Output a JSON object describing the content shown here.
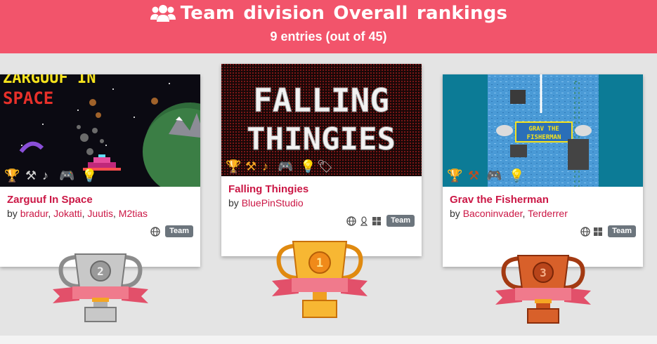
{
  "header": {
    "icon": "users-icon",
    "title": "Team division Overall rankings",
    "subtitle": "9 entries (out of 45)",
    "bg_color": "#f2546b"
  },
  "cards": [
    {
      "rank": 2,
      "thumb_text": "ZARGUUF IN SPACE",
      "title": "Zarguuf In Space",
      "by_prefix": "by",
      "authors": [
        "bradur",
        "Jokatti",
        "Juutis",
        "M2tias"
      ],
      "platforms": [
        "web-icon"
      ],
      "badge": "Team",
      "trophy": "silver-trophy"
    },
    {
      "rank": 1,
      "thumb_text_1": "FALLING",
      "thumb_text_2": "THINGIES",
      "title": "Falling Thingies",
      "by_prefix": "by",
      "authors": [
        "BluePinStudio"
      ],
      "platforms": [
        "web-icon",
        "linux-icon",
        "windows-icon"
      ],
      "badge": "Team",
      "trophy": "gold-trophy"
    },
    {
      "rank": 3,
      "thumb_text_1": "GRAV THE",
      "thumb_text_2": "FISHERMAN",
      "title": "Grav the Fisherman",
      "by_prefix": "by",
      "authors": [
        "Baconinvader",
        "Terderrer"
      ],
      "platforms": [
        "web-icon",
        "windows-icon"
      ],
      "badge": "Team",
      "trophy": "bronze-trophy"
    }
  ],
  "colors": {
    "link": "#cb1745",
    "badge": "#6c757d",
    "gold": "#f5a623",
    "silver": "#b8b8b8",
    "bronze": "#c84a1a"
  }
}
